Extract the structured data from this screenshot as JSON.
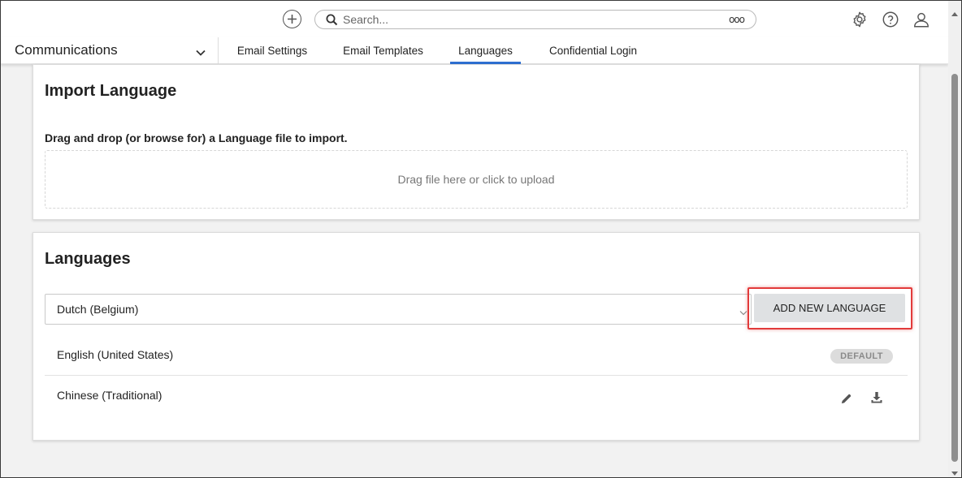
{
  "topbar": {
    "search_placeholder": "Search...",
    "more_glyph": "ooo",
    "icons": [
      "add-circle-icon",
      "search-icon",
      "settings-gear-icon",
      "help-question-icon",
      "user-profile-icon"
    ]
  },
  "navbar": {
    "module": "Communications",
    "tabs": [
      {
        "label": "Email Settings",
        "active": false
      },
      {
        "label": "Email Templates",
        "active": false
      },
      {
        "label": "Languages",
        "active": true
      },
      {
        "label": "Confidential Login",
        "active": false
      }
    ]
  },
  "import_card": {
    "title": "Import Language",
    "instructions": "Drag and drop (or browse for) a Language file to import.",
    "dropzone_text": "Drag file here or click to upload"
  },
  "languages_card": {
    "title": "Languages",
    "select_value": "Dutch (Belgium)",
    "add_button": "ADD NEW LANGUAGE",
    "rows": [
      {
        "name": "English (United States)",
        "badge": "DEFAULT"
      },
      {
        "name": "Chinese (Traditional)",
        "actions": [
          "edit-pencil-icon",
          "download-icon"
        ]
      }
    ]
  },
  "colors": {
    "accent": "#2e6fd1",
    "highlight": "#e23b3b",
    "button_bg": "#dfe1e3"
  }
}
